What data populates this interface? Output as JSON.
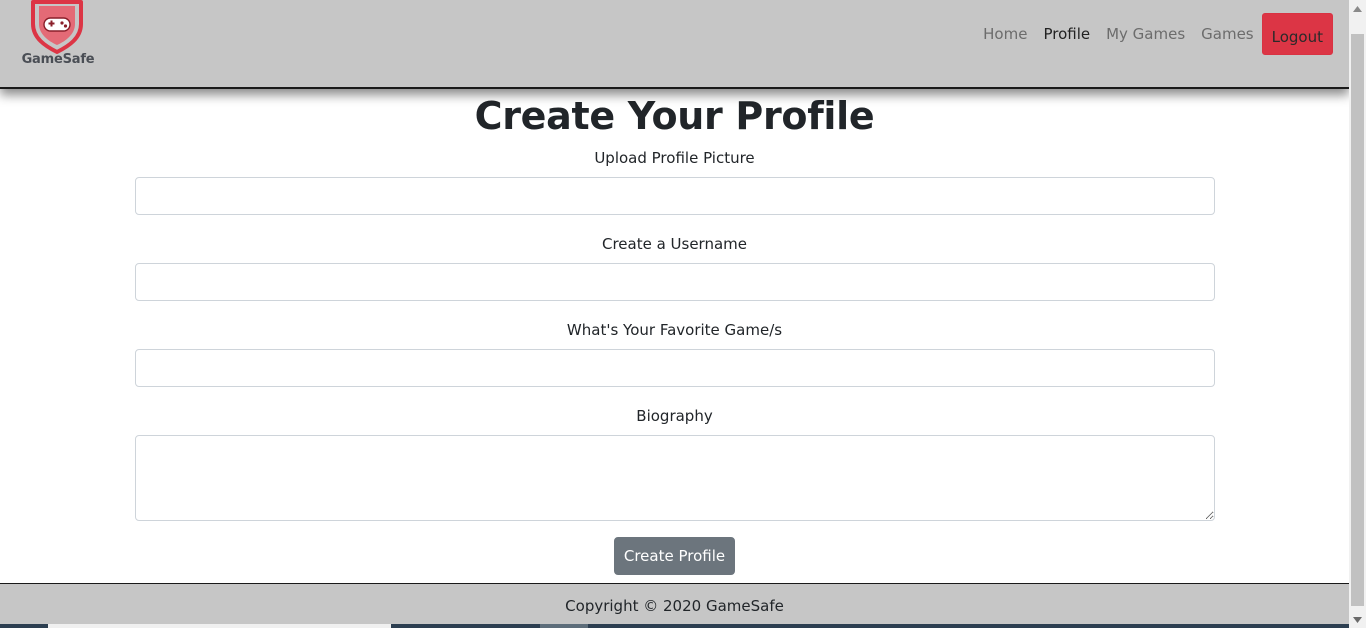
{
  "brand": {
    "name": "GameSafe",
    "icon": "gamepad-shield-icon",
    "color": "#dc3545"
  },
  "nav": {
    "items": [
      {
        "label": "Home",
        "active": false
      },
      {
        "label": "Profile",
        "active": true
      },
      {
        "label": "My Games",
        "active": false
      },
      {
        "label": "Games",
        "active": false
      }
    ],
    "logout_label": "Logout"
  },
  "form": {
    "title": "Create Your Profile",
    "fields": [
      {
        "label": "Upload Profile Picture",
        "value": ""
      },
      {
        "label": "Create a Username",
        "value": ""
      },
      {
        "label": "What's Your Favorite Game/s",
        "value": ""
      },
      {
        "label": "Biography",
        "value": ""
      }
    ],
    "submit_label": "Create Profile"
  },
  "footer": {
    "text": "Copyright © 2020 GameSafe"
  },
  "colors": {
    "navbar_bg": "#c6c6c6",
    "logout_bg": "#dc3545",
    "submit_bg": "#6c757d"
  }
}
